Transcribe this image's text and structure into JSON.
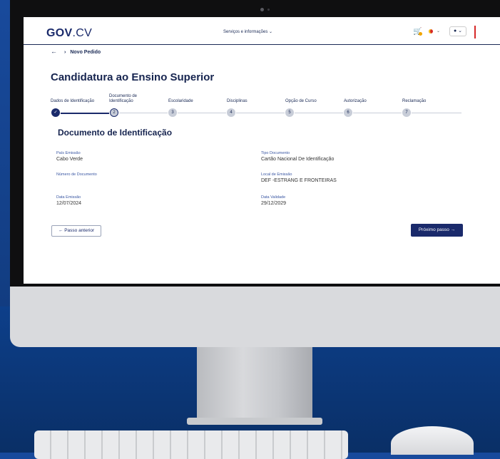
{
  "header": {
    "logo_main": "GOV",
    "logo_suffix": ".CV",
    "services_label": "Serviços e informações ⌄",
    "cart_icon": "cart-icon",
    "flag_icon": "flag-icon",
    "user_icon": "user-icon"
  },
  "breadcrumb": {
    "back_icon": "arrow-left-icon",
    "current": "Novo Pedido"
  },
  "page_title": "Candidatura ao Ensino Superior",
  "steps": [
    {
      "label": "Dados de Identificação",
      "num": "✓"
    },
    {
      "label": "Documento de Identificação",
      "num": "2"
    },
    {
      "label": "Escolaridade",
      "num": "3"
    },
    {
      "label": "Disciplinas",
      "num": "4"
    },
    {
      "label": "Opção de Curso",
      "num": "5"
    },
    {
      "label": "Autorização",
      "num": "6"
    },
    {
      "label": "Reclamação",
      "num": "7"
    }
  ],
  "section_title": "Documento de Identificação",
  "fields": {
    "pais_label": "País Emissão",
    "pais_value": "Cabo Verde",
    "tipo_label": "Tipo Documento",
    "tipo_value": "Cartão Nacional De Identificação",
    "numero_label": "Número de Documento",
    "numero_value": "",
    "local_label": "Local de Emissão",
    "local_value": "DEF -ESTRANG E FRONTEIRAS",
    "data_emissao_label": "Data Emissão",
    "data_emissao_value": "12/07/2024",
    "data_validade_label": "Data Validade",
    "data_validade_value": "29/12/2029"
  },
  "buttons": {
    "prev": "← Passo anterior",
    "next": "Próximo passo →"
  },
  "colors": {
    "primary": "#1a2a6b",
    "accent": "#d62828",
    "background": "#184a9c"
  }
}
